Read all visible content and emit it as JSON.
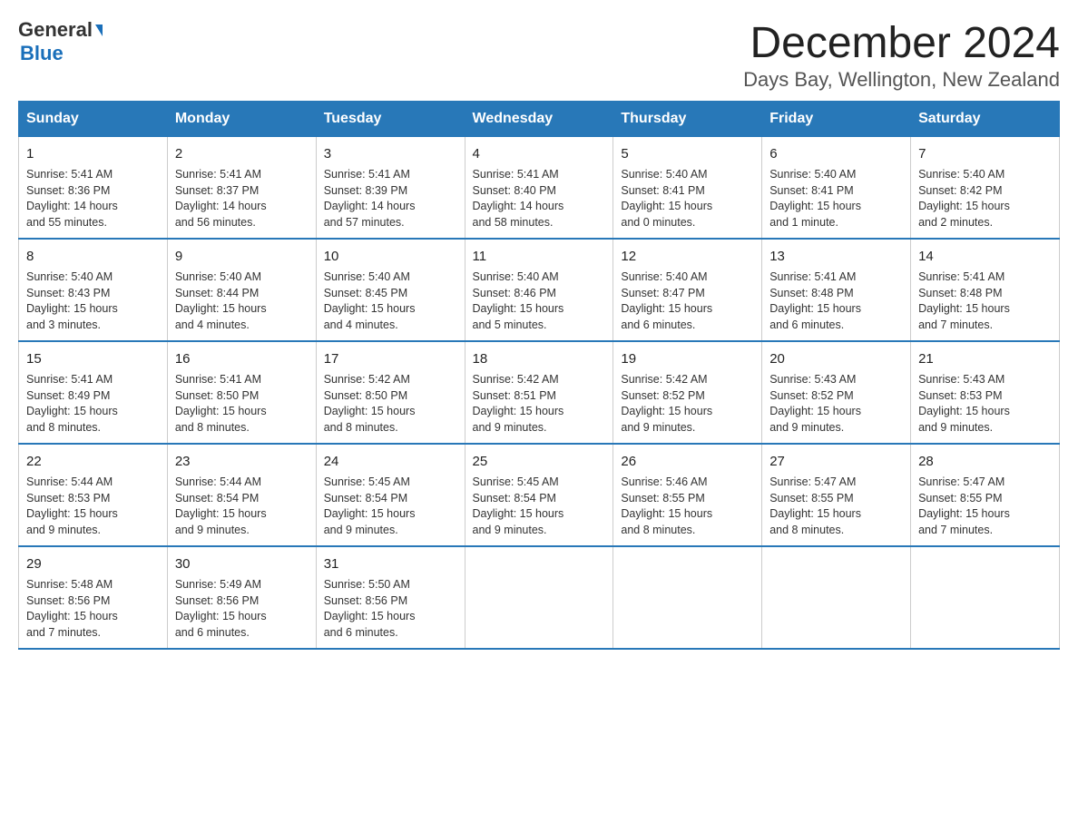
{
  "header": {
    "logo": {
      "general": "General",
      "blue": "Blue"
    },
    "month_title": "December 2024",
    "location": "Days Bay, Wellington, New Zealand"
  },
  "days_of_week": [
    "Sunday",
    "Monday",
    "Tuesday",
    "Wednesday",
    "Thursday",
    "Friday",
    "Saturday"
  ],
  "weeks": [
    [
      {
        "num": "1",
        "info": "Sunrise: 5:41 AM\nSunset: 8:36 PM\nDaylight: 14 hours\nand 55 minutes."
      },
      {
        "num": "2",
        "info": "Sunrise: 5:41 AM\nSunset: 8:37 PM\nDaylight: 14 hours\nand 56 minutes."
      },
      {
        "num": "3",
        "info": "Sunrise: 5:41 AM\nSunset: 8:39 PM\nDaylight: 14 hours\nand 57 minutes."
      },
      {
        "num": "4",
        "info": "Sunrise: 5:41 AM\nSunset: 8:40 PM\nDaylight: 14 hours\nand 58 minutes."
      },
      {
        "num": "5",
        "info": "Sunrise: 5:40 AM\nSunset: 8:41 PM\nDaylight: 15 hours\nand 0 minutes."
      },
      {
        "num": "6",
        "info": "Sunrise: 5:40 AM\nSunset: 8:41 PM\nDaylight: 15 hours\nand 1 minute."
      },
      {
        "num": "7",
        "info": "Sunrise: 5:40 AM\nSunset: 8:42 PM\nDaylight: 15 hours\nand 2 minutes."
      }
    ],
    [
      {
        "num": "8",
        "info": "Sunrise: 5:40 AM\nSunset: 8:43 PM\nDaylight: 15 hours\nand 3 minutes."
      },
      {
        "num": "9",
        "info": "Sunrise: 5:40 AM\nSunset: 8:44 PM\nDaylight: 15 hours\nand 4 minutes."
      },
      {
        "num": "10",
        "info": "Sunrise: 5:40 AM\nSunset: 8:45 PM\nDaylight: 15 hours\nand 4 minutes."
      },
      {
        "num": "11",
        "info": "Sunrise: 5:40 AM\nSunset: 8:46 PM\nDaylight: 15 hours\nand 5 minutes."
      },
      {
        "num": "12",
        "info": "Sunrise: 5:40 AM\nSunset: 8:47 PM\nDaylight: 15 hours\nand 6 minutes."
      },
      {
        "num": "13",
        "info": "Sunrise: 5:41 AM\nSunset: 8:48 PM\nDaylight: 15 hours\nand 6 minutes."
      },
      {
        "num": "14",
        "info": "Sunrise: 5:41 AM\nSunset: 8:48 PM\nDaylight: 15 hours\nand 7 minutes."
      }
    ],
    [
      {
        "num": "15",
        "info": "Sunrise: 5:41 AM\nSunset: 8:49 PM\nDaylight: 15 hours\nand 8 minutes."
      },
      {
        "num": "16",
        "info": "Sunrise: 5:41 AM\nSunset: 8:50 PM\nDaylight: 15 hours\nand 8 minutes."
      },
      {
        "num": "17",
        "info": "Sunrise: 5:42 AM\nSunset: 8:50 PM\nDaylight: 15 hours\nand 8 minutes."
      },
      {
        "num": "18",
        "info": "Sunrise: 5:42 AM\nSunset: 8:51 PM\nDaylight: 15 hours\nand 9 minutes."
      },
      {
        "num": "19",
        "info": "Sunrise: 5:42 AM\nSunset: 8:52 PM\nDaylight: 15 hours\nand 9 minutes."
      },
      {
        "num": "20",
        "info": "Sunrise: 5:43 AM\nSunset: 8:52 PM\nDaylight: 15 hours\nand 9 minutes."
      },
      {
        "num": "21",
        "info": "Sunrise: 5:43 AM\nSunset: 8:53 PM\nDaylight: 15 hours\nand 9 minutes."
      }
    ],
    [
      {
        "num": "22",
        "info": "Sunrise: 5:44 AM\nSunset: 8:53 PM\nDaylight: 15 hours\nand 9 minutes."
      },
      {
        "num": "23",
        "info": "Sunrise: 5:44 AM\nSunset: 8:54 PM\nDaylight: 15 hours\nand 9 minutes."
      },
      {
        "num": "24",
        "info": "Sunrise: 5:45 AM\nSunset: 8:54 PM\nDaylight: 15 hours\nand 9 minutes."
      },
      {
        "num": "25",
        "info": "Sunrise: 5:45 AM\nSunset: 8:54 PM\nDaylight: 15 hours\nand 9 minutes."
      },
      {
        "num": "26",
        "info": "Sunrise: 5:46 AM\nSunset: 8:55 PM\nDaylight: 15 hours\nand 8 minutes."
      },
      {
        "num": "27",
        "info": "Sunrise: 5:47 AM\nSunset: 8:55 PM\nDaylight: 15 hours\nand 8 minutes."
      },
      {
        "num": "28",
        "info": "Sunrise: 5:47 AM\nSunset: 8:55 PM\nDaylight: 15 hours\nand 7 minutes."
      }
    ],
    [
      {
        "num": "29",
        "info": "Sunrise: 5:48 AM\nSunset: 8:56 PM\nDaylight: 15 hours\nand 7 minutes."
      },
      {
        "num": "30",
        "info": "Sunrise: 5:49 AM\nSunset: 8:56 PM\nDaylight: 15 hours\nand 6 minutes."
      },
      {
        "num": "31",
        "info": "Sunrise: 5:50 AM\nSunset: 8:56 PM\nDaylight: 15 hours\nand 6 minutes."
      },
      null,
      null,
      null,
      null
    ]
  ]
}
